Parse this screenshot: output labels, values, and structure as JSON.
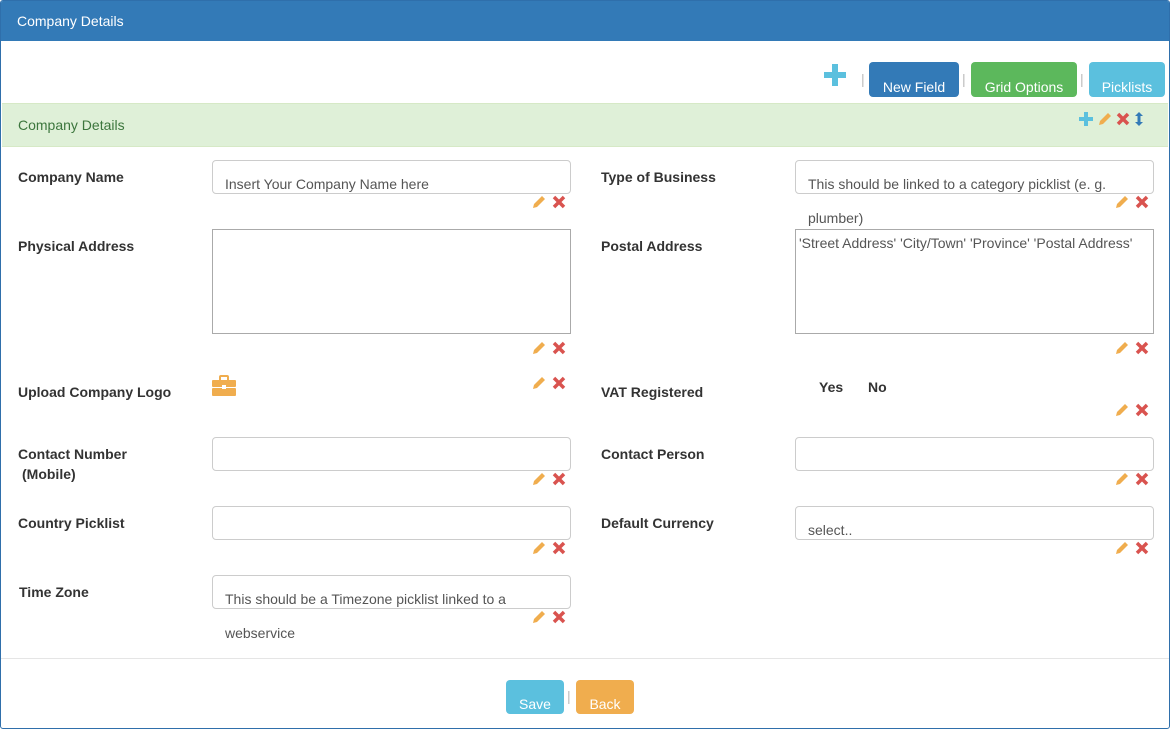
{
  "window": {
    "title": "Company Details"
  },
  "toolbar": {
    "add_icon": "plus-icon",
    "new_field_label": "New Field",
    "grid_options_label": "Grid Options",
    "picklists_label": "Picklists",
    "separator": "|"
  },
  "section": {
    "title": "Company Details",
    "icons": [
      "plus-icon",
      "pencil-icon",
      "close-icon",
      "sort-vertical-icon"
    ]
  },
  "fields": {
    "company_name": {
      "label": "Company Name",
      "placeholder": "Insert Your Company Name here"
    },
    "type_of_business": {
      "label": "Type of Business",
      "placeholder_line1": "This should be linked to a category picklist (e. g.",
      "placeholder_line2": "plumber)"
    },
    "physical_address": {
      "label": "Physical Address",
      "value": ""
    },
    "postal_address": {
      "label": "Postal Address",
      "value": "'Street Address' 'City/Town' 'Province' 'Postal Address'"
    },
    "upload_logo": {
      "label": "Upload Company Logo",
      "icon": "briefcase-icon"
    },
    "vat_registered": {
      "label": "VAT Registered",
      "yes": "Yes",
      "no": "No"
    },
    "contact_number": {
      "label_line1": "Contact Number",
      "label_line2": "(Mobile)"
    },
    "contact_person": {
      "label": "Contact Person"
    },
    "country_picklist": {
      "label": "Country Picklist"
    },
    "default_currency": {
      "label": "Default Currency",
      "value": "select.."
    },
    "time_zone": {
      "label": "Time Zone",
      "placeholder_line1": "This should be a Timezone picklist linked to a",
      "placeholder_line2": "webservice"
    }
  },
  "footer": {
    "save_label": "Save",
    "back_label": "Back",
    "separator": "|"
  },
  "colors": {
    "primary": "#337ab7",
    "success": "#5cb85c",
    "info": "#5bc0de",
    "warning": "#f0ad4e",
    "danger": "#d9534f",
    "section_bg": "#dff0d8",
    "section_text": "#3c763d"
  }
}
